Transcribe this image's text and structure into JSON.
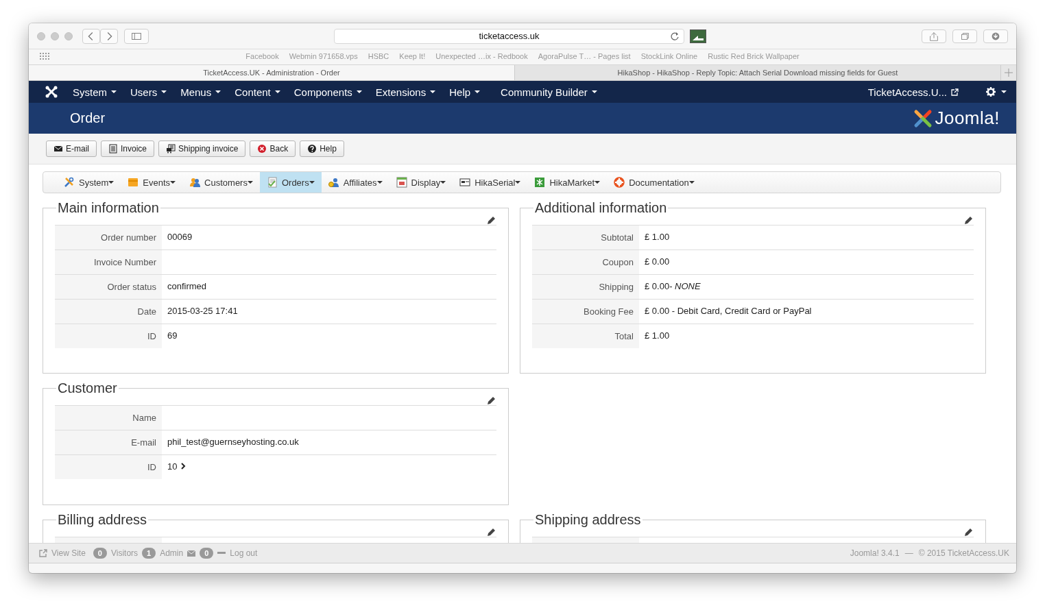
{
  "browser": {
    "address": "ticketaccess.uk",
    "bookmarks": [
      "Facebook",
      "Webmin 971658.vps",
      "HSBC",
      "Keep It!",
      "Unexpected …ix - Redbook",
      "AgoraPulse T… - Pages list",
      "StockLink Online",
      "Rustic Red Brick Wallpaper"
    ],
    "tabs": [
      {
        "title": "TicketAccess.UK - Administration - Order",
        "selected": true
      },
      {
        "title": "HikaShop - HikaShop - Reply Topic: Attach Serial Download missing fields for Guest",
        "selected": false
      }
    ]
  },
  "admin_menu": {
    "items": [
      "System",
      "Users",
      "Menus",
      "Content",
      "Components",
      "Extensions",
      "Help",
      "Community Builder"
    ],
    "site_link": "TicketAccess.U..."
  },
  "header": {
    "title": "Order",
    "logo": "Joomla!"
  },
  "toolbar": [
    {
      "label": "E-mail",
      "kind": "mail"
    },
    {
      "label": "Invoice",
      "kind": "invoice"
    },
    {
      "label": "Shipping invoice",
      "kind": "shipping"
    },
    {
      "label": "Back",
      "kind": "back"
    },
    {
      "label": "Help",
      "kind": "help"
    }
  ],
  "submenu": [
    {
      "label": "System",
      "kind": "tools",
      "selected": false
    },
    {
      "label": "Events",
      "kind": "events",
      "selected": false
    },
    {
      "label": "Customers",
      "kind": "customers",
      "selected": false
    },
    {
      "label": "Orders",
      "kind": "orders",
      "selected": true
    },
    {
      "label": "Affiliates",
      "kind": "affiliates",
      "selected": false
    },
    {
      "label": "Display",
      "kind": "display",
      "selected": false
    },
    {
      "label": "HikaSerial",
      "kind": "serial",
      "selected": false
    },
    {
      "label": "HikaMarket",
      "kind": "market",
      "selected": false
    },
    {
      "label": "Documentation",
      "kind": "docs",
      "selected": false
    }
  ],
  "panel_rows": [
    [
      {
        "title": "Main information",
        "rows": [
          {
            "label": "Order number",
            "value": "00069"
          },
          {
            "label": "Invoice Number"
          },
          {
            "label": "Order status",
            "value": "confirmed"
          },
          {
            "label": "Date",
            "value": "2015-03-25 17:41"
          },
          {
            "label": "ID",
            "value": "69"
          }
        ]
      },
      {
        "title": "Additional information",
        "rows": [
          {
            "label": "Subtotal",
            "value": "£ 1.00"
          },
          {
            "label": "Coupon",
            "value": "£ 0.00"
          },
          {
            "label": "Shipping",
            "value": "£ 0.00- *NONE*"
          },
          {
            "label": "Booking Fee",
            "value": "£ 0.00 - Debit Card, Credit Card or PayPal"
          },
          {
            "label": "Total",
            "value": "£ 1.00"
          }
        ]
      }
    ],
    [
      {
        "title": "Customer",
        "rows": [
          {
            "label": "Name"
          },
          {
            "label": "E-mail",
            "value": "phil_test@guernseyhosting.co.uk"
          },
          {
            "label": "ID",
            "value": "10",
            "link": true
          }
        ]
      }
    ],
    [
      {
        "title": "Billing address",
        "rows": [
          {}
        ]
      },
      {
        "title": "Shipping address",
        "rows": [
          {}
        ]
      }
    ]
  ],
  "status_bar": {
    "items": [
      {
        "kind": "link",
        "label": "View Site"
      },
      {
        "kind": "badge",
        "count": "0",
        "label": "Visitors"
      },
      {
        "kind": "badge",
        "count": "1",
        "label": "Admin"
      },
      {
        "kind": "mail",
        "count": "0"
      },
      {
        "kind": "logout",
        "label": "Log out"
      }
    ],
    "version": "Joomla! 3.4.1",
    "separator": "—",
    "copyright": "© 2015 TicketAccess.UK"
  }
}
